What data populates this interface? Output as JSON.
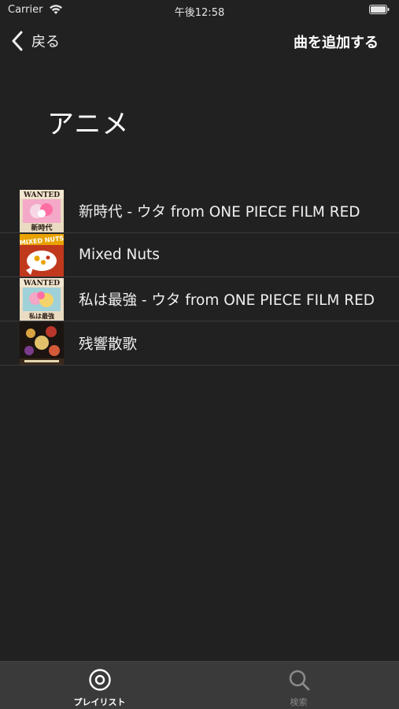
{
  "status_bar": {
    "carrier": "Carrier",
    "time": "午後12:58",
    "icons": [
      "wifi-icon",
      "battery-icon"
    ]
  },
  "nav": {
    "back_label": "戻る",
    "add_song_label": "曲を追加する"
  },
  "page": {
    "title": "アニメ"
  },
  "songs": [
    {
      "title": "新時代 - ウタ from ONE PIECE FILM RED",
      "artwork_text": "WANTED",
      "artwork_sub": "新時代"
    },
    {
      "title": "Mixed Nuts",
      "artwork_text": "MIXED NUTS",
      "artwork_sub": ""
    },
    {
      "title": "私は最強 - ウタ from ONE PIECE FILM RED",
      "artwork_text": "WANTED",
      "artwork_sub": "私は最強"
    },
    {
      "title": "残響散歌",
      "artwork_text": "",
      "artwork_sub": ""
    }
  ],
  "tab_bar": {
    "tabs": [
      {
        "label": "プレイリスト",
        "icon": "playlist-disc-icon",
        "selected": true
      },
      {
        "label": "検索",
        "icon": "search-icon",
        "selected": false
      }
    ]
  },
  "colors": {
    "background": "#212121",
    "tab_bar": "#3a3a3a",
    "separator": "#3a3a3a",
    "tab_selected": "#ffffff",
    "tab_unselected": "#8a8a8a"
  }
}
